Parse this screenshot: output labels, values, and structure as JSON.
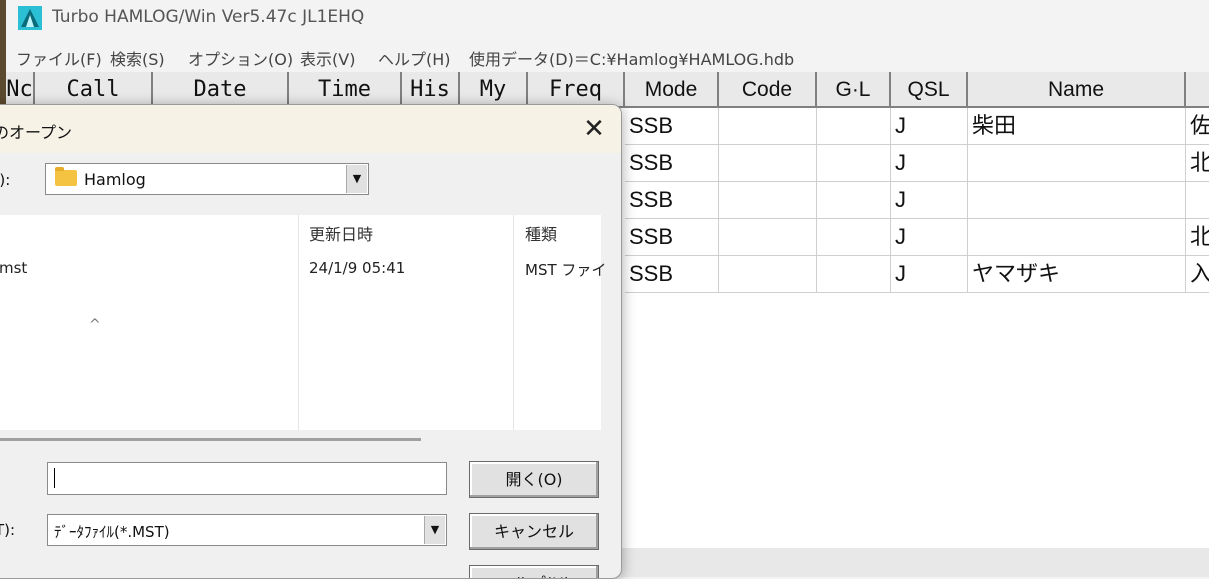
{
  "window": {
    "title": "Turbo HAMLOG/Win Ver5.47c JL1EHQ"
  },
  "menu": {
    "items": [
      "ファイル(F)",
      "検索(S)",
      "オプション(O)",
      "表示(V)",
      "ヘルプ(H)",
      "使用データ(D)＝C:¥Hamlog¥HAMLOG.hdb"
    ]
  },
  "grid": {
    "headers": [
      "Nc",
      "Call",
      "Date",
      "Time",
      "His",
      "My",
      "Freq",
      "Mode",
      "Code",
      "G·L",
      "QSL",
      "Name",
      ""
    ],
    "rows": [
      [
        "SSB",
        "",
        "",
        "J",
        "柴田",
        "佐"
      ],
      [
        "SSB",
        "",
        "",
        "J",
        "",
        "北"
      ],
      [
        "SSB",
        "",
        "",
        "J",
        "",
        ""
      ],
      [
        "SSB",
        "",
        "",
        "J",
        "",
        "北"
      ],
      [
        "SSB",
        "",
        "",
        "J",
        "ヤマザキ",
        "入"
      ]
    ]
  },
  "dialog": {
    "title": "のオープン",
    "close_glyph": "✕",
    "lookin_label": "I):",
    "lookin_value": "Hamlog",
    "sort_glyph": "^",
    "columns": {
      "date": "更新日時",
      "type": "種類"
    },
    "file": {
      "name": "mst",
      "date": "24/1/9 05:41",
      "type": "MST ファイ"
    },
    "filename_label": "",
    "filetype_label": "T):",
    "filetype_value": "ﾃﾞｰﾀﾌｧｲﾙ(*.MST)",
    "buttons": {
      "open": "開く(O)",
      "cancel": "キャンセル",
      "help": "ヘルプ(H)"
    }
  },
  "colors": {
    "accent": "#2bbfd6",
    "title_bg": "#f6f2e6",
    "header_bg": "#e9e9e9"
  }
}
